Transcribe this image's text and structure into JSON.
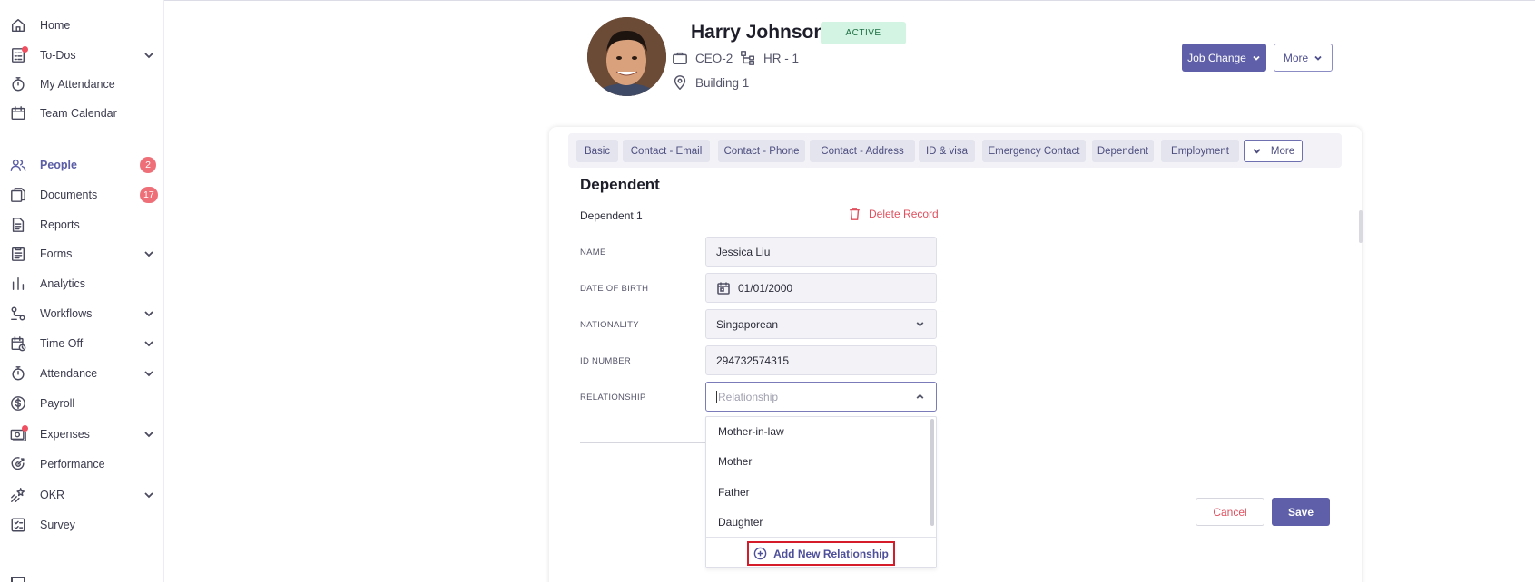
{
  "sidebar": {
    "items": [
      {
        "label": "Home",
        "icon": "home-icon",
        "chevron": false,
        "badge": "",
        "dot": false,
        "active": false
      },
      {
        "label": "To-Dos",
        "icon": "todo-list-icon",
        "chevron": true,
        "badge": "",
        "dot": true,
        "active": false
      },
      {
        "label": "My Attendance",
        "icon": "stopwatch-icon",
        "chevron": false,
        "badge": "",
        "dot": false,
        "active": false
      },
      {
        "label": "Team Calendar",
        "icon": "calendar-icon",
        "chevron": false,
        "badge": "",
        "dot": false,
        "active": false
      },
      {
        "label": "People",
        "icon": "people-icon",
        "chevron": false,
        "badge": "2",
        "dot": false,
        "active": true
      },
      {
        "label": "Documents",
        "icon": "documents-icon",
        "chevron": false,
        "badge": "17",
        "dot": false,
        "active": false
      },
      {
        "label": "Reports",
        "icon": "report-icon",
        "chevron": false,
        "badge": "",
        "dot": false,
        "active": false
      },
      {
        "label": "Forms",
        "icon": "form-icon",
        "chevron": true,
        "badge": "",
        "dot": false,
        "active": false
      },
      {
        "label": "Analytics",
        "icon": "bar-chart-icon",
        "chevron": false,
        "badge": "",
        "dot": false,
        "active": false
      },
      {
        "label": "Workflows",
        "icon": "workflow-icon",
        "chevron": true,
        "badge": "",
        "dot": false,
        "active": false
      },
      {
        "label": "Time Off",
        "icon": "time-off-icon",
        "chevron": true,
        "badge": "",
        "dot": false,
        "active": false
      },
      {
        "label": "Attendance",
        "icon": "stopwatch-icon",
        "chevron": true,
        "badge": "",
        "dot": false,
        "active": false
      },
      {
        "label": "Payroll",
        "icon": "dollar-icon",
        "chevron": false,
        "badge": "",
        "dot": false,
        "active": false
      },
      {
        "label": "Expenses",
        "icon": "expenses-icon",
        "chevron": true,
        "badge": "",
        "dot": true,
        "active": false
      },
      {
        "label": "Performance",
        "icon": "performance-icon",
        "chevron": false,
        "badge": "",
        "dot": false,
        "active": false
      },
      {
        "label": "OKR",
        "icon": "okr-icon",
        "chevron": true,
        "badge": "",
        "dot": false,
        "active": false
      },
      {
        "label": "Survey",
        "icon": "survey-icon",
        "chevron": false,
        "badge": "",
        "dot": false,
        "active": false
      }
    ]
  },
  "header": {
    "name": "Harry Johnson",
    "status": "ACTIVE",
    "position": "CEO-2",
    "department": "HR - 1",
    "location": "Building 1",
    "job_change_label": "Job Change",
    "more_label": "More"
  },
  "tabs": [
    "Basic",
    "Contact - Email",
    "Contact - Phone",
    "Contact - Address",
    "ID & visa",
    "Emergency Contact",
    "Dependent",
    "Employment"
  ],
  "tab_more_label": "More",
  "form": {
    "section_title": "Dependent",
    "record_title": "Dependent 1",
    "delete_label": "Delete Record",
    "name_label": "NAME",
    "name_value": "Jessica Liu",
    "dob_label": "DATE OF BIRTH",
    "dob_value": "01/01/2000",
    "nationality_label": "NATIONALITY",
    "nationality_value": "Singaporean",
    "id_label": "ID NUMBER",
    "id_value": "294732574315",
    "relationship_label": "RELATIONSHIP",
    "relationship_placeholder": "Relationship",
    "relationship_options": [
      "Mother-in-law",
      "Mother",
      "Father",
      "Daughter"
    ],
    "add_relationship_label": "Add New Relationship",
    "cancel_label": "Cancel",
    "save_label": "Save"
  },
  "colors": {
    "accent": "#5e5fa8",
    "danger": "#e0505f",
    "badge": "#ef6f78",
    "active_bg": "#d3f4e2"
  }
}
